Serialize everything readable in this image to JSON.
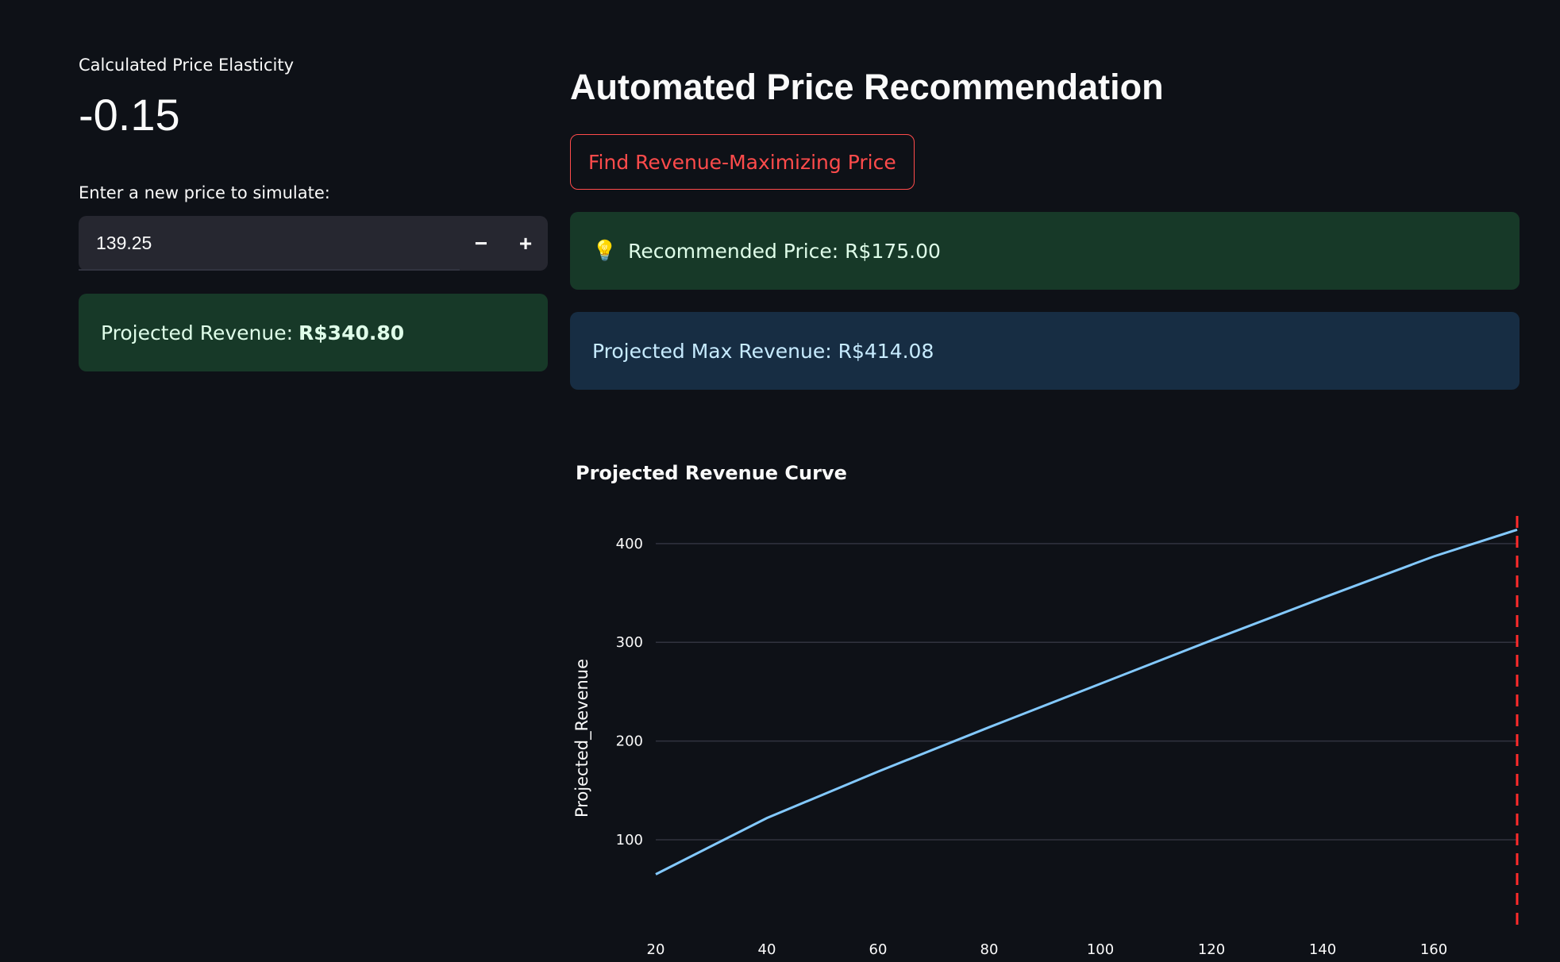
{
  "metric": {
    "label": "Calculated Price Elasticity",
    "value": "-0.15"
  },
  "simulator": {
    "label": "Enter a new price to simulate:",
    "value": "139.25",
    "decrement": "−",
    "increment": "+",
    "projected_revenue_label": "Projected Revenue:",
    "projected_revenue_value": "R$340.80"
  },
  "recommendation": {
    "title": "Automated Price Recommendation",
    "button_label": "Find Revenue-Maximizing Price",
    "recommended_price": "Recommended Price: R$175.00",
    "max_revenue": "Projected Max Revenue: R$414.08"
  },
  "colors": {
    "background": "#0e1117",
    "line": "#83c9ff",
    "marker": "#ff2b2b",
    "button_accent": "#ff4b4b"
  },
  "icons": {
    "bulb": "💡"
  },
  "chart_data": {
    "type": "line",
    "title": "Projected Revenue Curve",
    "xlabel": "",
    "ylabel": "Projected_Revenue",
    "x_ticks": [
      20,
      40,
      60,
      80,
      100,
      120,
      140,
      160
    ],
    "y_ticks": [
      100,
      200,
      300,
      400
    ],
    "xlim": [
      20,
      175
    ],
    "ylim": [
      30,
      420
    ],
    "grid": "horizontal",
    "series": [
      {
        "x": [
          20,
          40,
          60,
          80,
          100,
          120,
          140,
          160,
          175
        ],
        "y": [
          65,
          122,
          169,
          214,
          258,
          302,
          345,
          387,
          414.08
        ]
      }
    ],
    "rule": {
      "x": 175,
      "style": "dashed"
    }
  }
}
